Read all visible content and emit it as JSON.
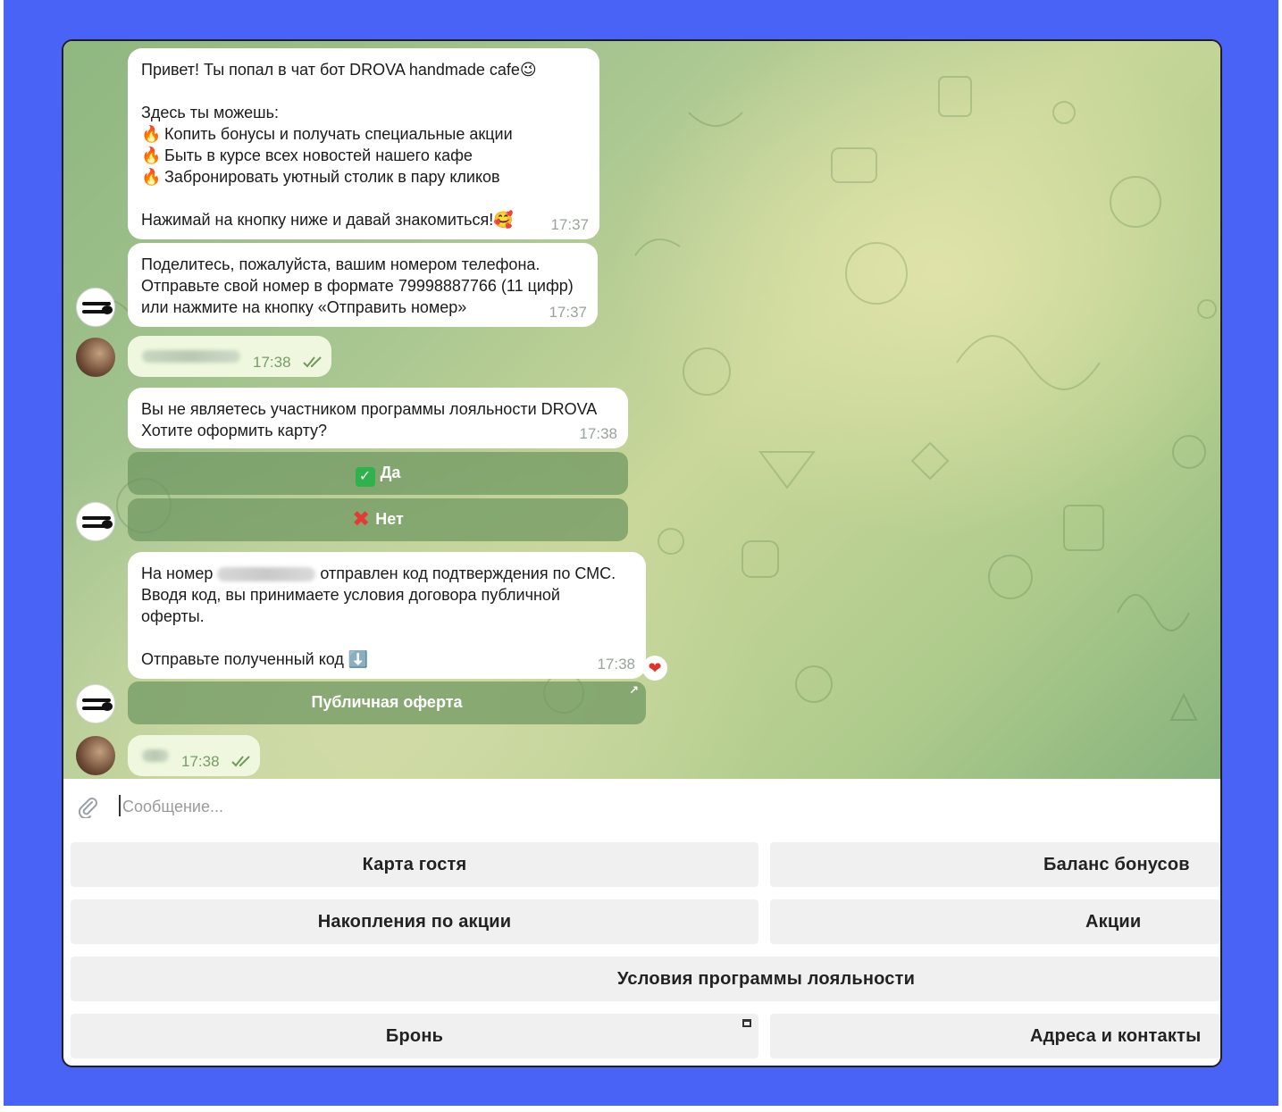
{
  "messages": {
    "welcome": {
      "line1": "Привет! Ты попал в чат бот DROVA handmade cafe😉",
      "line2": "Здесь ты можешь:",
      "bullet1": "Копить бонусы и получать специальные акции",
      "bullet2": "Быть в курсе всех новостей нашего кафе",
      "bullet3": "Забронировать уютный столик в пару кликов",
      "bullet_icon": "🔥",
      "line3": "Нажимай на кнопку ниже и давай знакомиться!🥰",
      "time": "17:37"
    },
    "phone_request": {
      "line1": "Поделитесь, пожалуйста, вашим номером телефона.",
      "line2": "Отправьте свой номер в формате 79998887766 (11 цифр)",
      "line3": "или нажмите на кнопку «Отправить номер»",
      "time": "17:37"
    },
    "user_phone": {
      "time": "17:38",
      "status_icon": "double-check-icon"
    },
    "loyalty_prompt": {
      "line1": "Вы не являетесь участником программы лояльности DROVA",
      "line2": "Хотите оформить карту?",
      "time": "17:38",
      "btn_yes": "Да",
      "btn_no": "Нет"
    },
    "sms_sent": {
      "line1_pre": "На номер",
      "line1_post": "отправлен код подтверждения по СМС.",
      "line2": "Вводя код, вы принимаете условия договора публичной",
      "line3": "оферты.",
      "line4": "Отправьте полученный код ⬇️",
      "time": "17:38",
      "reaction": "❤",
      "link_button": "Публичная оферта"
    },
    "user_code": {
      "time": "17:38",
      "status_icon": "double-check-icon"
    }
  },
  "composer": {
    "placeholder": "Сообщение..."
  },
  "keyboard": {
    "guest_card": "Карта гостя",
    "bonus_balance": "Баланс бонусов",
    "promo_savings": "Накопления по акции",
    "promos": "Акции",
    "loyalty_terms": "Условия программы лояльности",
    "booking": "Бронь",
    "addresses": "Адреса и контакты"
  },
  "colors": {
    "frame": "#4a63f7",
    "outgoing_bubble": "#eff8de",
    "inline_button": "#6e965f",
    "keyboard_button": "#f0f0f0"
  }
}
